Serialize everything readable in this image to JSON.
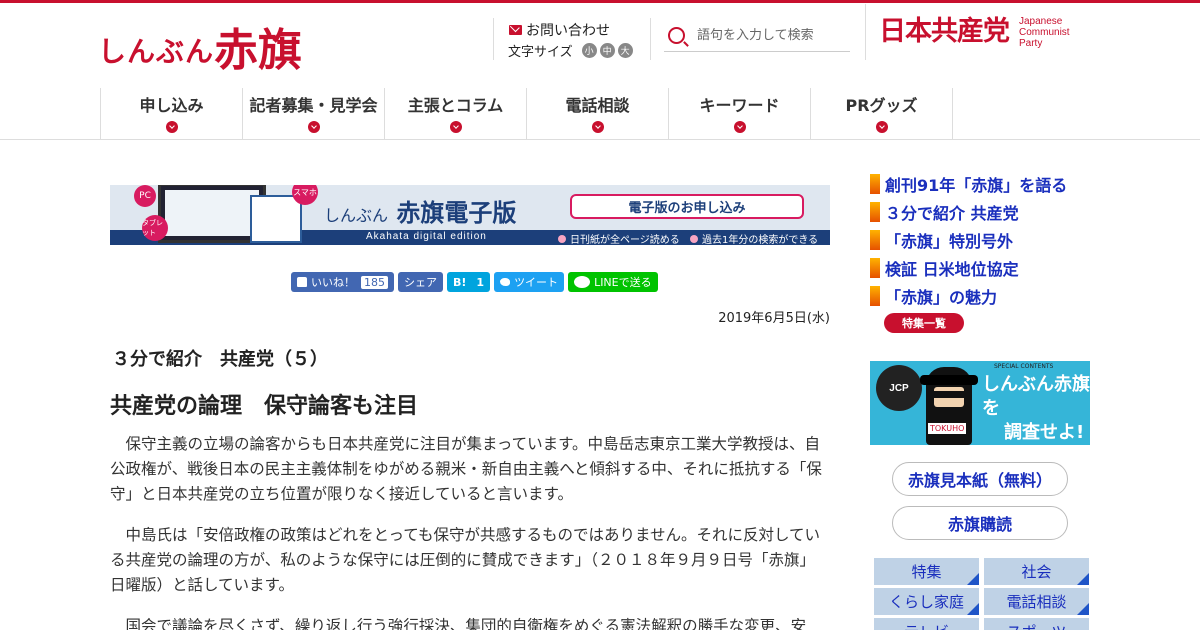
{
  "header": {
    "logo_small": "しんぶん",
    "logo_big": "赤旗",
    "contact_label": "お問い合わせ",
    "fontsize_label": "文字サイズ",
    "fontsize_options": [
      "小",
      "中",
      "大"
    ],
    "search_placeholder": "語句を入力して検索",
    "party_name_jp": "日本共産党",
    "party_name_en": [
      "Japanese",
      "Communist",
      "Party"
    ]
  },
  "nav": [
    "申し込み",
    "記者募集・見学会",
    "主張とコラム",
    "電話相談",
    "キーワード",
    "PRグッズ"
  ],
  "banner": {
    "brand_small": "しんぶん",
    "brand_big": "赤旗電子版",
    "edition_text": "Akahata digital edition",
    "cta": "電子版のお申し込み",
    "feature1": "日刊紙が全ページ読める",
    "feature2": "過去1年分の検索ができる",
    "badge_pc": "PC",
    "badge_tablet": "タブレット",
    "badge_phone": "スマホ"
  },
  "share": {
    "like_label": "いいね！",
    "like_count": "185",
    "share_label": "シェア",
    "hatena_label": "B!",
    "hatena_count": "1",
    "tweet_label": "ツイート",
    "line_label": "LINEで送る"
  },
  "article": {
    "date": "2019年6月5日(水)",
    "series": "３分で紹介　共産党（５）",
    "headline": "共産党の論理　保守論客も注目",
    "paragraphs": [
      "保守主義の立場の論客からも日本共産党に注目が集まっています。中島岳志東京工業大学教授は、自公政権が、戦後日本の民主主義体制をゆがめる親米・新自由主義へと傾斜する中、それに抵抗する「保守」と日本共産党の立ち位置が限りなく接近していると言います。",
      "中島氏は「安倍政権の政策はどれをとっても保守が共感するものではありません。それに反対している共産党の論理の方が、私のような保守には圧倒的に賛成できます」（２０１８年９月９日号「赤旗」日曜版）と話しています。",
      "国会で議論を尽くさず、繰り返し行う強行採決、集団的自衛権をめぐる憲法解釈の勝手な変更、安"
    ]
  },
  "sidebar": {
    "features": [
      "創刊91年「赤旗」を語る",
      "３分で紹介 共産党",
      "「赤旗」特別号外",
      "検証 日米地位協定",
      "「赤旗」の魅力"
    ],
    "features_button": "特集一覧",
    "promo_title_1": "しんぶん赤旗を",
    "promo_title_2": "調査せよ!",
    "promo_circle": "JCP",
    "promo_top": "SPECIAL CONTENTS",
    "promo_tag": "TOKUHO",
    "sample_label": "赤旗見本紙（無料）",
    "subscribe_label": "赤旗購読",
    "categories": [
      "特集",
      "社会",
      "くらし家庭",
      "電話相談",
      "テレビ",
      "スポーツ"
    ]
  }
}
